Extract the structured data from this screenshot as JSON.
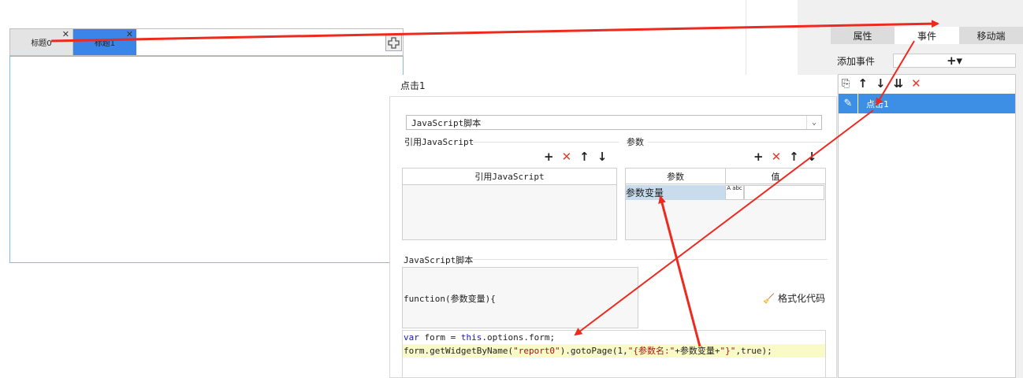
{
  "left_tabs": {
    "tabs": [
      {
        "label": "标题0",
        "close": "✕"
      },
      {
        "label": "标题1",
        "close": "✕"
      }
    ],
    "add_icon": "plus-outline-icon"
  },
  "right_panel": {
    "tabs": [
      "属性",
      "事件",
      "移动端"
    ],
    "active_tab": "事件",
    "add_event_label": "添加事件",
    "add_event_button": "+▾",
    "toolbar_icons": [
      "copy-icon",
      "arrow-up-icon",
      "arrow-down-icon",
      "move-bottom-icon",
      "delete-icon"
    ],
    "toolbar_glyphs": [
      "⎘",
      "↑",
      "↓",
      "⇊",
      "✕"
    ],
    "events": [
      {
        "label": "点击1",
        "icon": "pencil-icon",
        "selected": true
      }
    ]
  },
  "dialog": {
    "title": "点击1",
    "type_select": "JavaScript脚本",
    "ref_js": {
      "section_label": "引用JavaScript",
      "column": "引用JavaScript"
    },
    "params": {
      "section_label": "参数",
      "columns": [
        "参数",
        "值"
      ],
      "rows": [
        {
          "name": "参数变量",
          "type_icon": "A abc",
          "value": ""
        }
      ]
    },
    "script_section_label": "JavaScript脚本",
    "function_signature": "function(参数变量){",
    "format_code_label": "格式化代码",
    "code": {
      "line1": {
        "kw1": "var",
        "t1": " form = ",
        "kw2": "this",
        "t2": ".options.form;"
      },
      "line2": {
        "t1": "form.getWidgetByName(",
        "s1": "\"report0\"",
        "t2": ").gotoPage(1,",
        "s2": "\"{参数名:\"",
        "t3": "+参数变量+",
        "s3": "\"}\"",
        "t4": ",true);"
      }
    }
  },
  "colors": {
    "accent": "#3d8ee5",
    "arrow": "#ee2a1f",
    "highlight_row": "#c8dcee",
    "code_line_highlight": "#fafac8"
  }
}
